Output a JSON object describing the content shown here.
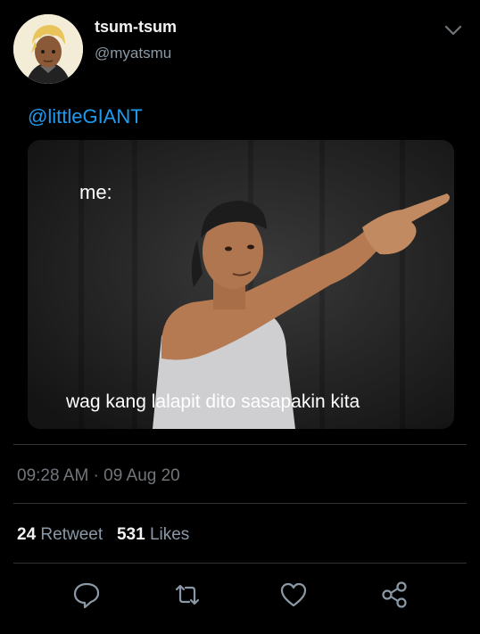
{
  "tweet": {
    "author": {
      "display_name": "tsum-tsum",
      "handle": "@myatsmu"
    },
    "text": "@littleGIANT",
    "media": {
      "top_text": "me:",
      "caption": "wag kang lalapit dito sasapakin kita"
    },
    "timestamp": "09:28 AM · 09 Aug 20",
    "stats": {
      "retweets_count": "24",
      "retweets_label": "Retweet",
      "likes_count": "531",
      "likes_label": "Likes"
    },
    "actions": {
      "icons": [
        "reply-icon",
        "retweet-icon",
        "like-icon",
        "share-icon"
      ]
    }
  },
  "colors": {
    "background": "#000000",
    "link": "#1d9bf0",
    "secondary_text": "#8b98a5",
    "divider": "#2f3336"
  }
}
